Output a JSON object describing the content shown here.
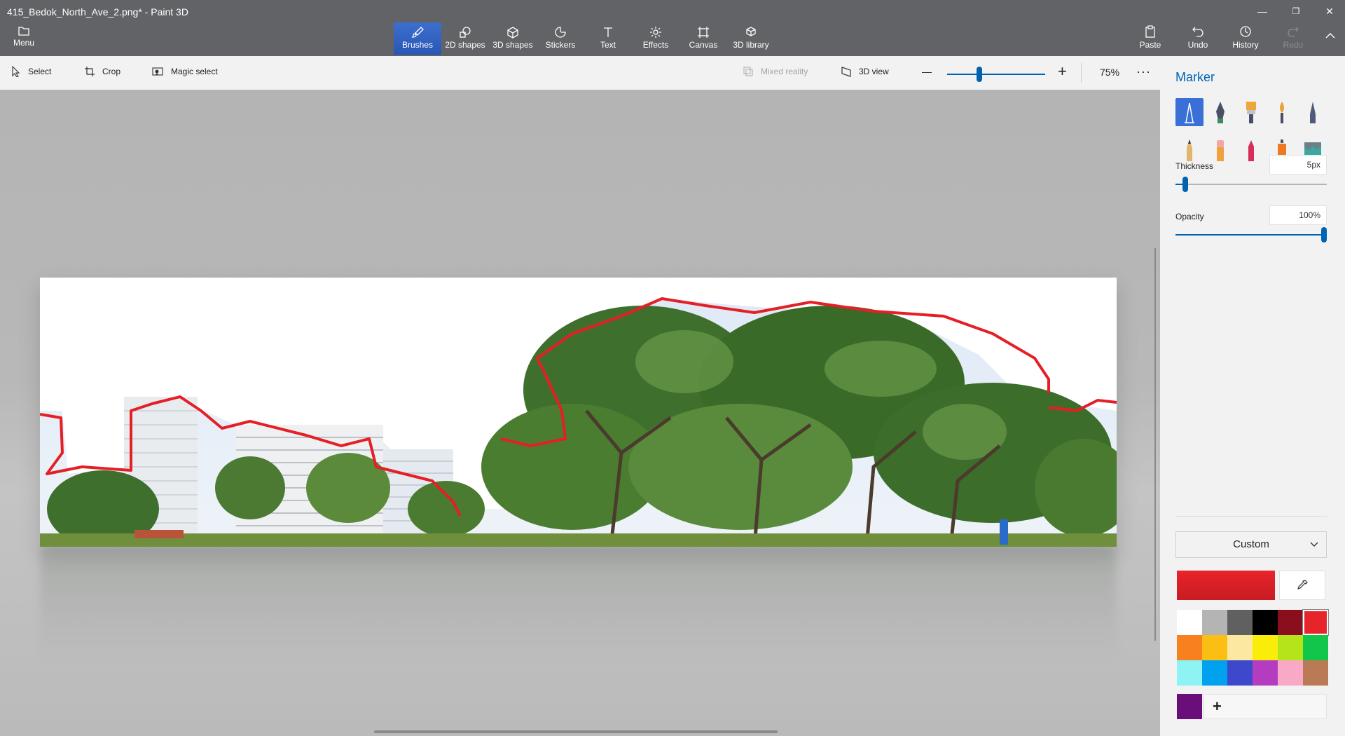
{
  "window": {
    "title": "415_Bedok_North_Ave_2.png* - Paint 3D",
    "controls": [
      "—",
      "❐",
      "✕"
    ]
  },
  "ribbon": {
    "menu_label": "Menu",
    "tools": [
      {
        "label": "Brushes",
        "icon": "brush-icon",
        "active": true
      },
      {
        "label": "2D shapes",
        "icon": "2d-shapes-icon"
      },
      {
        "label": "3D shapes",
        "icon": "3d-shapes-icon"
      },
      {
        "label": "Stickers",
        "icon": "stickers-icon"
      },
      {
        "label": "Text",
        "icon": "text-icon"
      },
      {
        "label": "Effects",
        "icon": "effects-icon"
      },
      {
        "label": "Canvas",
        "icon": "canvas-icon"
      },
      {
        "label": "3D library",
        "icon": "3d-library-icon"
      }
    ],
    "right": [
      {
        "label": "Paste",
        "icon": "paste-icon"
      },
      {
        "label": "Undo",
        "icon": "undo-icon"
      },
      {
        "label": "History",
        "icon": "history-icon"
      },
      {
        "label": "Redo",
        "icon": "redo-icon",
        "disabled": true
      }
    ]
  },
  "toolbar": {
    "select": "Select",
    "crop": "Crop",
    "magic_select": "Magic select",
    "mixed_reality": "Mixed reality",
    "view_3d": "3D view",
    "zoom_minus": "—",
    "zoom_plus": "+",
    "zoom": "75%",
    "more": "···",
    "zoom_level": 0.3
  },
  "panel": {
    "title": "Marker",
    "brushes": [
      {
        "name": "marker",
        "color": "#2b3d8f",
        "selected": true
      },
      {
        "name": "calligraphy-pen",
        "color": "#3c8c5b"
      },
      {
        "name": "oil-brush",
        "color": "#e8a23a"
      },
      {
        "name": "watercolor",
        "color": "#e8a23a"
      },
      {
        "name": "pixel-pen",
        "color": "#505a7a"
      },
      {
        "name": "pencil",
        "color": "#d9a24c"
      },
      {
        "name": "eraser",
        "color": "#f0a03c"
      },
      {
        "name": "crayon",
        "color": "#d72d5a"
      },
      {
        "name": "spray-can",
        "color": "#f07820"
      },
      {
        "name": "fill",
        "color": "#3aa8a0"
      }
    ],
    "thickness_label": "Thickness",
    "thickness_value": "5px",
    "thickness_level": 0.05,
    "opacity_label": "Opacity",
    "opacity_value": "100%",
    "opacity_level": 1.0,
    "custom_label": "Custom",
    "current_color": "#e8242b",
    "palette": [
      "#ffffff",
      "#b4b4b4",
      "#606060",
      "#000000",
      "#8a0f1d",
      "#e8242b",
      "#f7801f",
      "#fbbf14",
      "#fde8a2",
      "#faed09",
      "#b5e41b",
      "#12c64a",
      "#8df3f3",
      "#00a2ef",
      "#3e48cc",
      "#b33cc1",
      "#f8a9c6",
      "#b97a56"
    ],
    "custom_swatch": "#6a0f7a",
    "add_label": "+"
  }
}
